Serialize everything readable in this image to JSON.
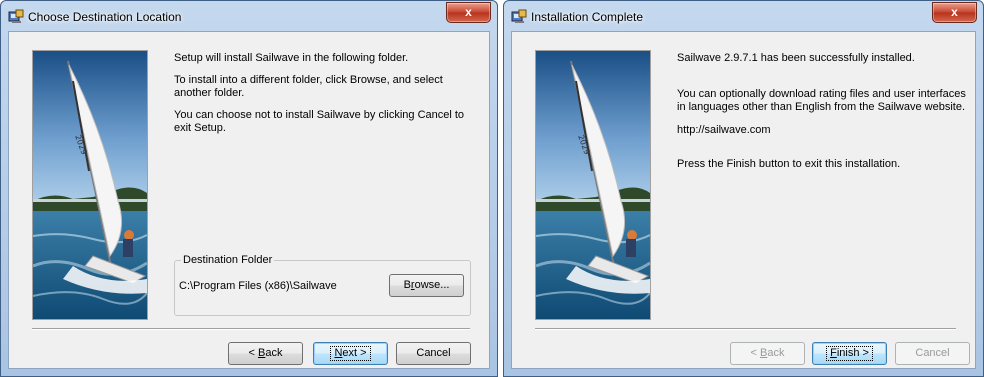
{
  "dialog1": {
    "title": "Choose Destination Location",
    "close_label": "x",
    "lines": [
      "Setup will install Sailwave in the following folder.",
      "To install into a different folder, click Browse, and select another folder.",
      "You can choose not to install Sailwave by clicking Cancel to exit Setup."
    ],
    "group_label": "Destination Folder",
    "folder_path": "C:\\Program Files (x86)\\Sailwave",
    "browse": {
      "pre": "B",
      "key": "r",
      "post": "owse..."
    },
    "back": {
      "pre": "< ",
      "key": "B",
      "post": "ack"
    },
    "next": {
      "pre": "",
      "key": "N",
      "post": "ext >"
    },
    "cancel_label": "Cancel"
  },
  "dialog2": {
    "title": "Installation Complete",
    "close_label": "x",
    "lines": [
      "Sailwave 2.9.7.1 has been successfully installed.",
      "You can optionally download rating files and user interfaces in languages other than English from the Sailwave website.",
      "http://sailwave.com",
      "Press the Finish button to exit this installation."
    ],
    "back": {
      "pre": "< ",
      "key": "B",
      "post": "ack"
    },
    "finish": {
      "pre": "",
      "key": "F",
      "post": "inish >"
    },
    "cancel_label": "Cancel"
  }
}
